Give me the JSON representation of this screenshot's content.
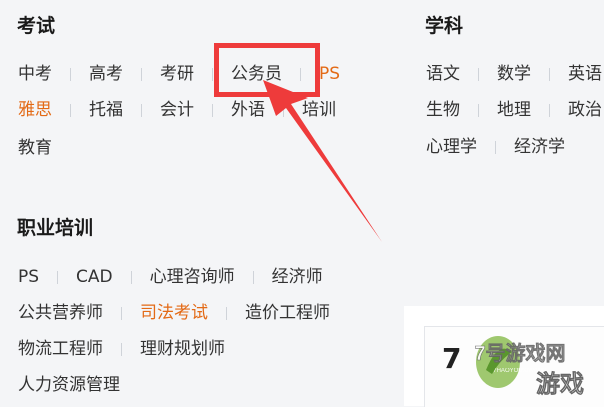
{
  "exam": {
    "title": "考试",
    "rows": [
      [
        {
          "label": "中考",
          "hot": false
        },
        {
          "label": "高考",
          "hot": false
        },
        {
          "label": "考研",
          "hot": false
        },
        {
          "label": "公务员",
          "hot": false
        },
        {
          "label": "PS",
          "hot": true
        }
      ],
      [
        {
          "label": "雅思",
          "hot": true
        },
        {
          "label": "托福",
          "hot": false
        },
        {
          "label": "会计",
          "hot": false
        },
        {
          "label": "外语",
          "hot": false
        },
        {
          "label": "培训",
          "hot": false
        }
      ],
      [
        {
          "label": "教育",
          "hot": false
        }
      ]
    ]
  },
  "subject": {
    "title": "学科",
    "rows": [
      [
        {
          "label": "语文",
          "hot": false
        },
        {
          "label": "数学",
          "hot": false
        },
        {
          "label": "英语",
          "hot": false
        }
      ],
      [
        {
          "label": "生物",
          "hot": false
        },
        {
          "label": "地理",
          "hot": false
        },
        {
          "label": "政治",
          "hot": false
        }
      ],
      [
        {
          "label": "心理学",
          "hot": false
        },
        {
          "label": "经济学",
          "hot": false
        }
      ]
    ]
  },
  "vocational": {
    "title": "职业培训",
    "rows": [
      [
        {
          "label": "PS",
          "hot": false
        },
        {
          "label": "CAD",
          "hot": false
        },
        {
          "label": "心理咨询师",
          "hot": false
        },
        {
          "label": "经济师",
          "hot": false
        }
      ],
      [
        {
          "label": "公共营养师",
          "hot": false
        },
        {
          "label": "司法考试",
          "hot": true
        },
        {
          "label": "造价工程师",
          "hot": false
        }
      ],
      [
        {
          "label": "物流工程师",
          "hot": false
        },
        {
          "label": "理财规划师",
          "hot": false
        }
      ],
      [
        {
          "label": "人力资源管理",
          "hot": false
        }
      ]
    ]
  },
  "card": {
    "text": "7"
  },
  "watermark": {
    "main": "7号游戏网",
    "pinyin": "7HAOYOUXIWANG",
    "sub": "游戏"
  },
  "colors": {
    "hot": "#e36a16",
    "annotation": "#ee3b3b"
  }
}
